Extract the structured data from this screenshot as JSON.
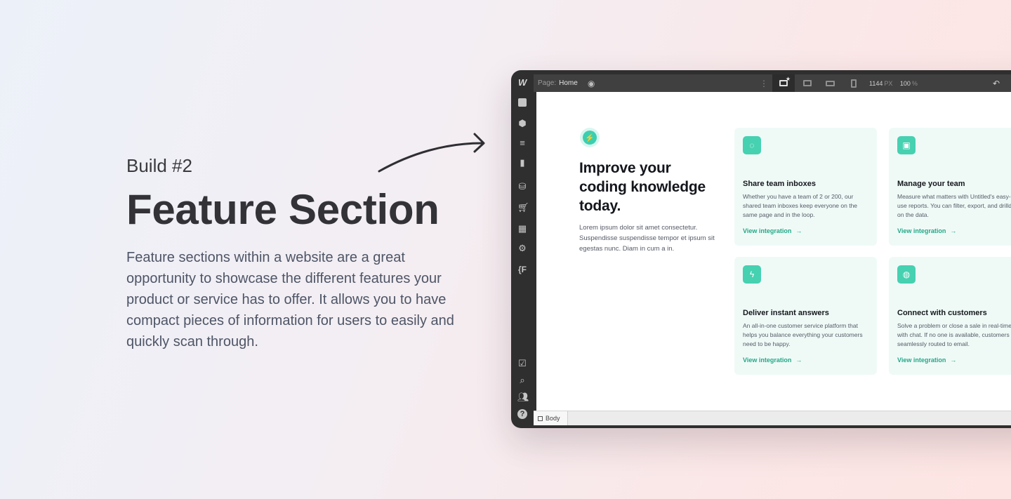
{
  "intro": {
    "kicker": "Build #2",
    "title": "Feature Section",
    "description": "Feature sections within a website are a great opportunity to showcase the different features your product or service has to offer. It allows you to have compact pieces of information for users to easily and quickly scan through."
  },
  "editor": {
    "logo": "W",
    "page_label": "Page:",
    "page_name": "Home",
    "eye_icon": "eye-icon",
    "canvas_width": "1144",
    "canvas_width_unit": "PX",
    "zoom": "100",
    "zoom_unit": "%",
    "breadcrumb": "Body",
    "sidebar_icons": [
      "add-icon",
      "box-icon",
      "navigator-icon",
      "pages-icon",
      "cms-icon",
      "ecommerce-icon",
      "assets-icon",
      "settings-icon",
      "code-icon",
      "checklist-icon",
      "search-icon",
      "users-icon",
      "help-icon"
    ],
    "code_glyph": "{F",
    "help_glyph": "?"
  },
  "preview": {
    "hero_title": "Improve your coding knowledge today.",
    "hero_description": "Lorem ipsum dolor sit amet consectetur. Suspendisse suspendisse tempor et ipsum sit egestas nunc. Diam in cum a in.",
    "cards": [
      {
        "icon": "chat-icon",
        "title": "Share team inboxes",
        "description": "Whether you have a team of 2 or 200, our shared team inboxes keep everyone on the same page and in the loop.",
        "link": "View integration"
      },
      {
        "icon": "chart-icon",
        "title": "Manage your team",
        "description": "Measure what matters with Untitled's easy-to-use reports. You can filter, export, and drilldown on the data.",
        "link": "View integration"
      },
      {
        "icon": "lightning-icon",
        "title": "Deliver instant answers",
        "description": "An all-in-one customer service platform that helps you balance everything your customers need to be happy.",
        "link": "View integration"
      },
      {
        "icon": "message-icon",
        "title": "Connect with customers",
        "description": "Solve a problem or close a sale in real-time with chat. If no one is available, customers are seamlessly routed to email.",
        "link": "View integration"
      }
    ]
  },
  "colors": {
    "accent": "#46d1b1",
    "link": "#23a887",
    "card_bg": "#effaf7"
  }
}
